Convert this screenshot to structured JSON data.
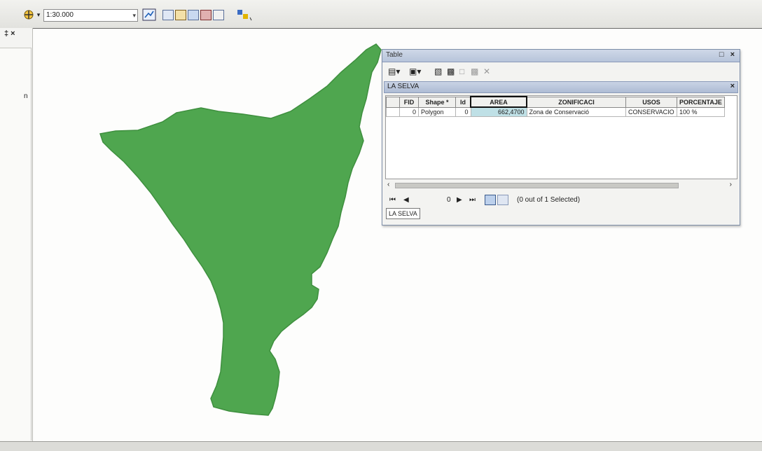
{
  "toolbar": {
    "scale_value": "1:30.000",
    "icons": [
      "add-data-icon",
      "graph-icon",
      "table-icon",
      "layout-icon",
      "identify-icon",
      "report-icon",
      "window-icon",
      "editor-icon"
    ]
  },
  "left_dock": {
    "pin_label": "‡ ×",
    "partial_text": "n"
  },
  "table_window": {
    "title": "Table",
    "title_controls": "□ ×",
    "layer_tab_title": "LA SELVA",
    "columns": [
      "",
      "FID",
      "Shape *",
      "Id",
      "AREA",
      "ZONIFICACI",
      "USOS",
      "PORCENTAJE"
    ],
    "rows": [
      {
        "selector": "",
        "fid": "0",
        "shape": "Polygon",
        "id": "0",
        "area": "662,4700",
        "zonificaci": "Zona de Conservació",
        "usos": "CONSERVACIO",
        "porcentaje": "100 %"
      }
    ],
    "record_number": "0",
    "selection_status": "(0 out of 1 Selected)",
    "bottom_tab": "LA SELVA"
  },
  "colors": {
    "polygon_fill": "#4fa64f",
    "polygon_edge": "#3e8f3e",
    "window_title": "#b7c4da"
  }
}
